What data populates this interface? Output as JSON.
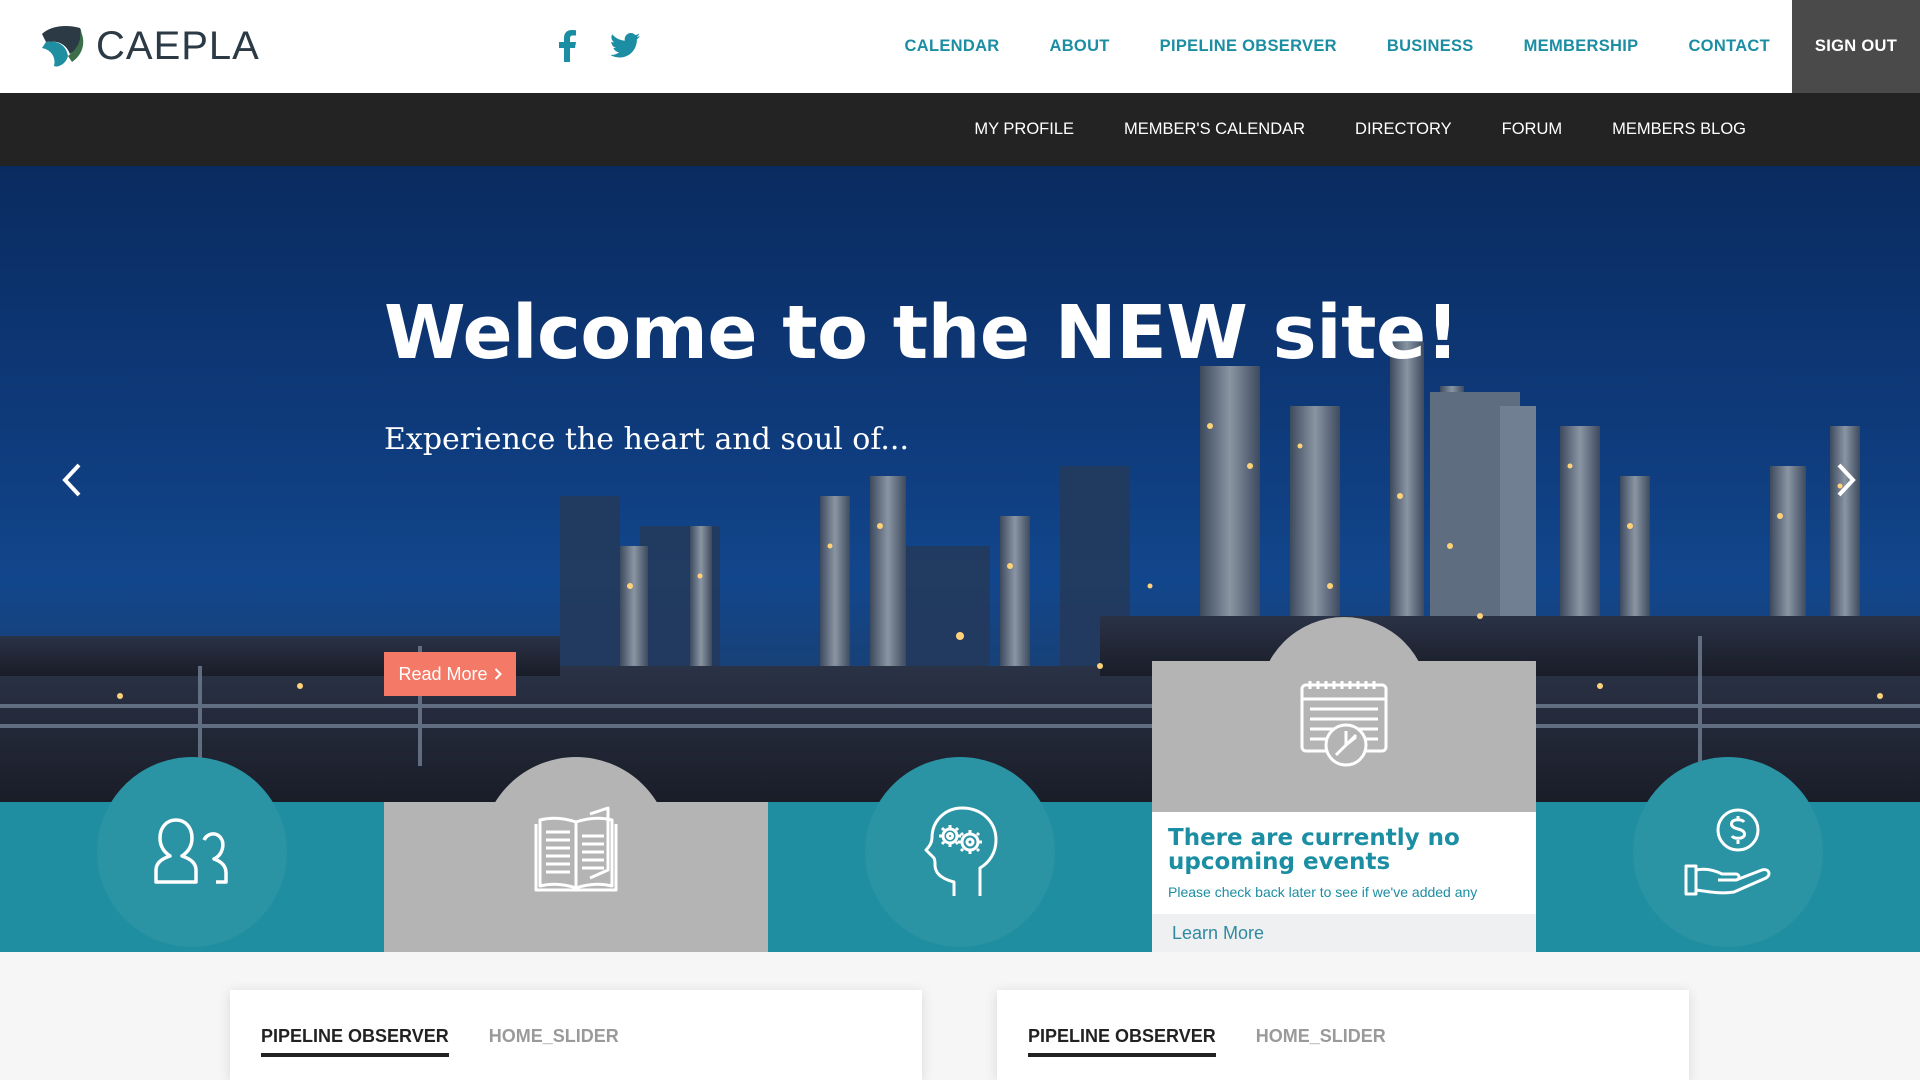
{
  "brand": {
    "name": "CAEPLA",
    "logo_teal": "#1e8ea0",
    "logo_dark": "#2b3a45"
  },
  "social": {
    "facebook_icon": "facebook-icon",
    "twitter_icon": "twitter-icon"
  },
  "main_nav": {
    "items": [
      "CALENDAR",
      "ABOUT",
      "PIPELINE OBSERVER",
      "BUSINESS",
      "MEMBERSHIP",
      "CONTACT"
    ],
    "sign_out": "SIGN OUT"
  },
  "sub_nav": {
    "items": [
      "MY PROFILE",
      "MEMBER'S CALENDAR",
      "DIRECTORY",
      "FORUM",
      "MEMBERS BLOG"
    ]
  },
  "hero": {
    "title": "Welcome to the NEW site!",
    "subtitle": "Experience the heart and soul of...",
    "cta": "Read More",
    "cta_icon": "chevron-right-icon",
    "prev_icon": "chevron-left-icon",
    "next_icon": "chevron-right-icon"
  },
  "features": {
    "tiles": [
      {
        "icon": "members-icon"
      },
      {
        "icon": "book-icon"
      },
      {
        "icon": "head-gears-icon"
      },
      {
        "icon": "calendar-icon"
      },
      {
        "icon": "hand-dollar-icon"
      }
    ],
    "events": {
      "title": "There are currently no upcoming events",
      "note": "Please check back later to see if we've added any",
      "link": "Learn More"
    }
  },
  "panels": [
    {
      "tabs": [
        "PIPELINE OBSERVER",
        "HOME_SLIDER"
      ],
      "active": 0
    },
    {
      "tabs": [
        "PIPELINE OBSERVER",
        "HOME_SLIDER"
      ],
      "active": 0
    }
  ],
  "colors": {
    "teal": "#1e8ea0",
    "nav_text": "#1b8ea3",
    "dark_bar": "#232323",
    "sign_out_bg": "#4a4a4a",
    "gray_tile": "#b4b4b4",
    "cta": "#f47a67"
  }
}
